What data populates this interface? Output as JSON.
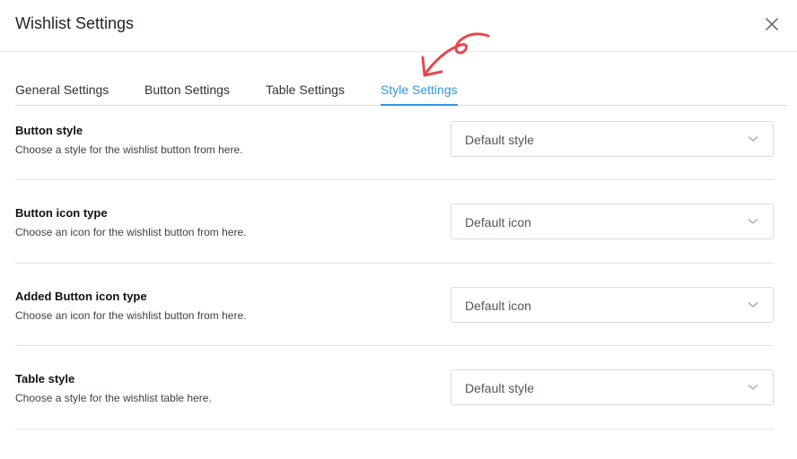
{
  "dialog": {
    "title": "Wishlist Settings"
  },
  "tabs": [
    {
      "label": "General Settings",
      "active": false
    },
    {
      "label": "Button Settings",
      "active": false
    },
    {
      "label": "Table Settings",
      "active": false
    },
    {
      "label": "Style Settings",
      "active": true
    }
  ],
  "settings": [
    {
      "title": "Button style",
      "description": "Choose a style for the wishlist button from here.",
      "value": "Default style"
    },
    {
      "title": "Button icon type",
      "description": "Choose an icon for the wishlist button from here.",
      "value": "Default icon"
    },
    {
      "title": "Added Button icon type",
      "description": "Choose an icon for the wishlist button from here.",
      "value": "Default icon"
    },
    {
      "title": "Table style",
      "description": "Choose a style for the wishlist table here.",
      "value": "Default style"
    }
  ],
  "colors": {
    "accent": "#2f96e6",
    "annotation_arrow": "#e5484d"
  },
  "icons": {
    "close": "close-icon",
    "dropdown": "chevron-down-icon",
    "annotation": "curved-arrow-annotation"
  }
}
